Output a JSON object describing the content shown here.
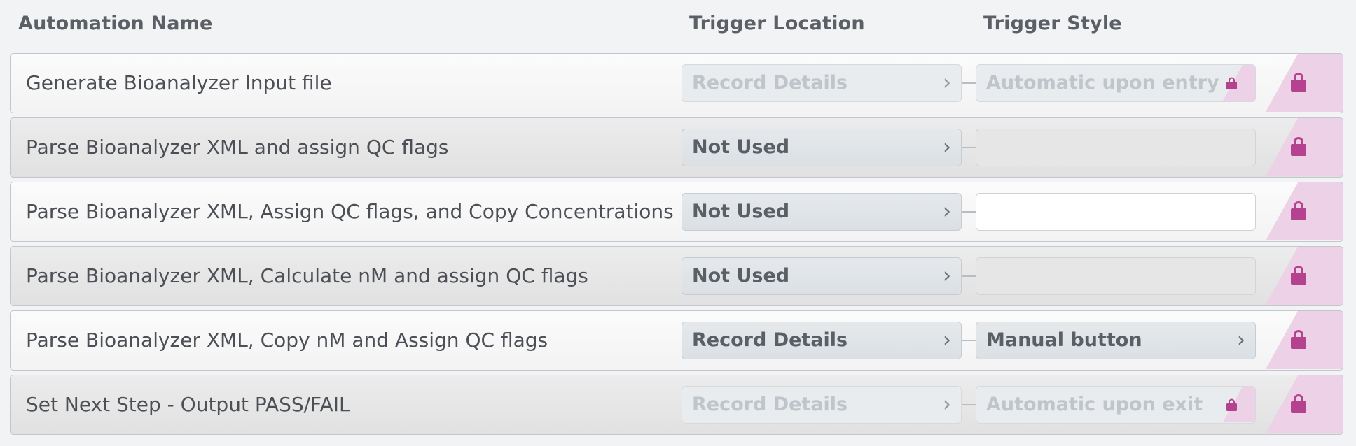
{
  "headers": {
    "name": "Automation Name",
    "location": "Trigger Location",
    "style": "Trigger Style"
  },
  "colors": {
    "lock": "#b4428f",
    "lock_stripe": "#edd1e6"
  },
  "rows": [
    {
      "name": "Generate Bioanalyzer Input file",
      "trigger_location": "Record Details",
      "trigger_style": "Automatic upon entry",
      "location_enabled": false,
      "style_locked": true
    },
    {
      "name": "Parse Bioanalyzer XML and assign QC flags",
      "trigger_location": "Not Used",
      "trigger_style": "",
      "location_enabled": true,
      "style_locked": false
    },
    {
      "name": "Parse Bioanalyzer XML, Assign QC flags, and Copy Concentrations",
      "trigger_location": "Not Used",
      "trigger_style": "",
      "location_enabled": true,
      "style_locked": false
    },
    {
      "name": "Parse Bioanalyzer XML, Calculate nM and assign QC flags",
      "trigger_location": "Not Used",
      "trigger_style": "",
      "location_enabled": true,
      "style_locked": false
    },
    {
      "name": "Parse Bioanalyzer XML, Copy nM and Assign QC flags",
      "trigger_location": "Record Details",
      "trigger_style": "Manual button",
      "location_enabled": true,
      "style_locked": false
    },
    {
      "name": "Set Next Step - Output PASS/FAIL",
      "trigger_location": "Record Details",
      "trigger_style": "Automatic upon exit",
      "location_enabled": false,
      "style_locked": true
    }
  ]
}
